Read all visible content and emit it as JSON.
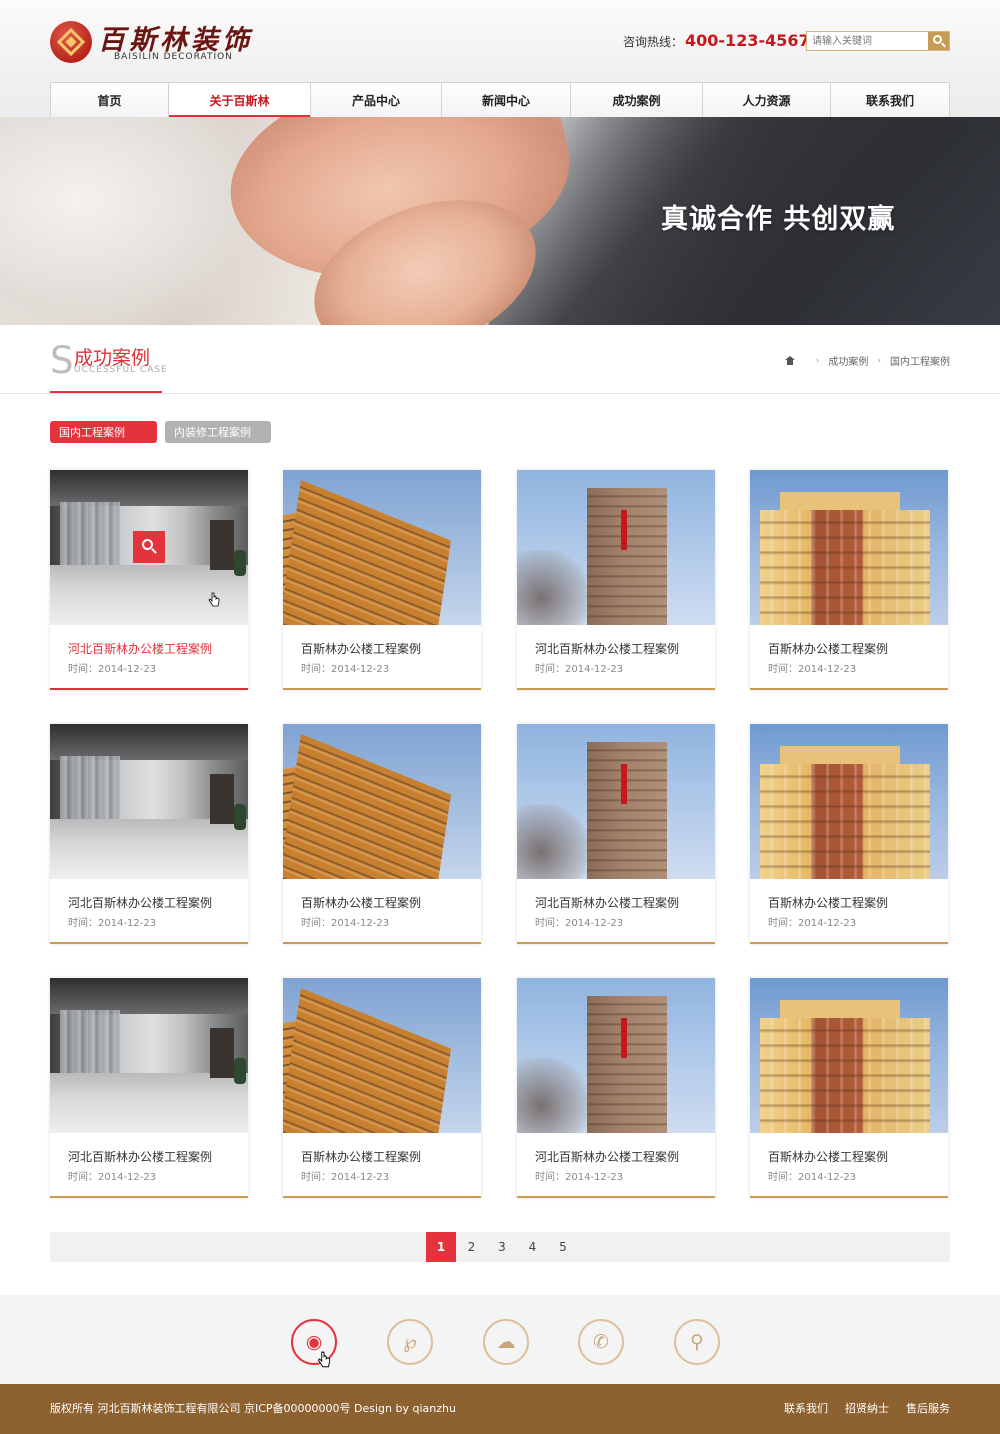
{
  "header": {
    "logo_cn": "百斯林装饰",
    "logo_en": "BAISILIN  DECORATION",
    "hotline_label": "咨询热线：",
    "hotline_number": "400-123-4567",
    "search_placeholder": "请输入关键词",
    "accent_color": "#c8161d"
  },
  "nav": [
    "首页",
    "关于百斯林",
    "产品中心",
    "新闻中心",
    "成功案例",
    "人力资源",
    "联系我们"
  ],
  "nav_active": "关于百斯林",
  "banner": {
    "slogan": "真诚合作  共创双赢"
  },
  "section": {
    "initial": "S",
    "title_cn": "成功案例",
    "title_en": "UCCESSFUL CASE"
  },
  "breadcrumb": [
    "成功案例",
    "国内工程案例"
  ],
  "tabs": [
    {
      "label": "国内工程案例",
      "active": true
    },
    {
      "label": "内装修工程案例",
      "active": false
    }
  ],
  "cases": [
    {
      "title": "河北百斯林办公楼工程案例",
      "date": "时间：2014-12-23",
      "image": "corridor",
      "active": true
    },
    {
      "title": "百斯林办公楼工程案例",
      "date": "时间：2014-12-23",
      "image": "tower"
    },
    {
      "title": "河北百斯林办公楼工程案例",
      "date": "时间：2014-12-23",
      "image": "tall"
    },
    {
      "title": "百斯林办公楼工程案例",
      "date": "时间：2014-12-23",
      "image": "low"
    },
    {
      "title": "河北百斯林办公楼工程案例",
      "date": "时间：2014-12-23",
      "image": "corridor"
    },
    {
      "title": "百斯林办公楼工程案例",
      "date": "时间：2014-12-23",
      "image": "tower"
    },
    {
      "title": "河北百斯林办公楼工程案例",
      "date": "时间：2014-12-23",
      "image": "tall"
    },
    {
      "title": "百斯林办公楼工程案例",
      "date": "时间：2014-12-23",
      "image": "low"
    },
    {
      "title": "河北百斯林办公楼工程案例",
      "date": "时间：2014-12-23",
      "image": "corridor"
    },
    {
      "title": "百斯林办公楼工程案例",
      "date": "时间：2014-12-23",
      "image": "tower"
    },
    {
      "title": "河北百斯林办公楼工程案例",
      "date": "时间：2014-12-23",
      "image": "tall"
    },
    {
      "title": "百斯林办公楼工程案例",
      "date": "时间：2014-12-23",
      "image": "low"
    }
  ],
  "pagination": {
    "pages": [
      "1",
      "2",
      "3",
      "4",
      "5"
    ],
    "current": "1"
  },
  "social": [
    {
      "name": "weibo-icon",
      "glyph": "◉",
      "active": true
    },
    {
      "name": "qq-weibo-icon",
      "glyph": "℘",
      "active": false
    },
    {
      "name": "wechat-icon",
      "glyph": "☁",
      "active": false
    },
    {
      "name": "phone-icon",
      "glyph": "✆",
      "active": false
    },
    {
      "name": "location-icon",
      "glyph": "⚲",
      "active": false
    }
  ],
  "footer": {
    "copyright": "版权所有  河北百斯林装饰工程有限公司  京ICP备00000000号  Design by qianzhu",
    "links": [
      "联系我们",
      "招贤纳士",
      "售后服务"
    ]
  }
}
